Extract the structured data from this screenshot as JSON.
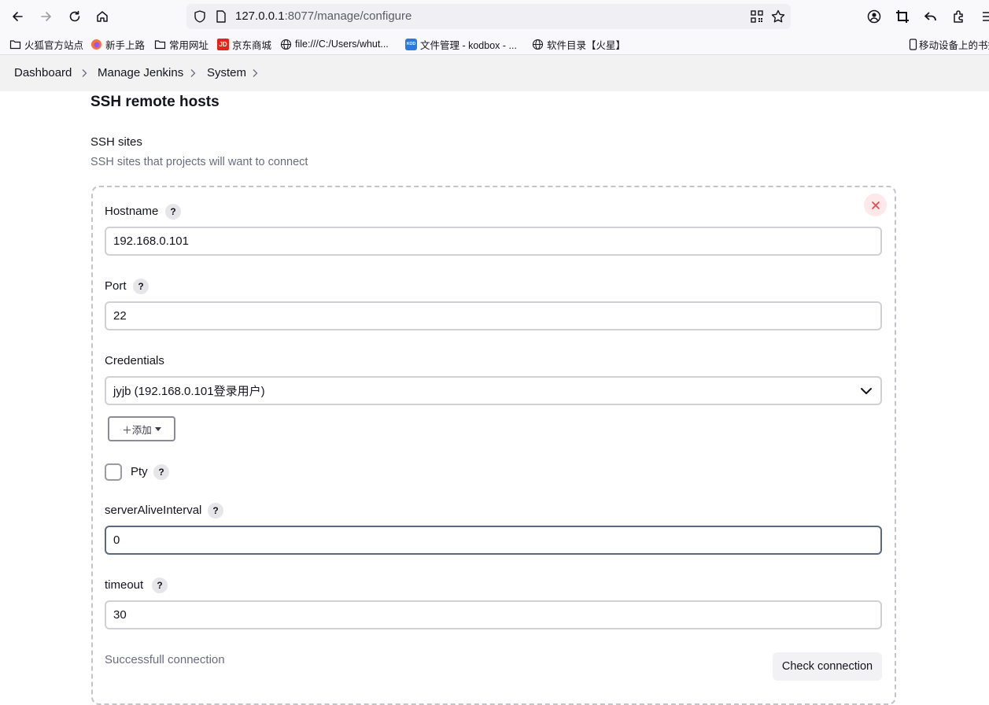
{
  "browser": {
    "url_host": "127.0.0.1",
    "url_rest": ":8077/manage/configure",
    "bookmarks": [
      {
        "label": "火狐官方站点",
        "icon": "folder-icon"
      },
      {
        "label": "新手上路",
        "icon": "firefox-icon"
      },
      {
        "label": "常用网址",
        "icon": "folder-icon"
      },
      {
        "label": "京东商城",
        "icon": "jd-icon"
      },
      {
        "label": "file:///C:/Users/whut...",
        "icon": "globe-icon"
      },
      {
        "label": "文件管理 - kodbox - ...",
        "icon": "kodbox-icon"
      },
      {
        "label": "软件目录【火星】",
        "icon": "globe-icon"
      },
      {
        "label": "移动设备上的书签",
        "icon": "mobile-icon"
      }
    ],
    "jd_label": "JD",
    "kod_label": "KOD"
  },
  "breadcrumb": {
    "items": [
      "Dashboard",
      "Manage Jenkins",
      "System"
    ]
  },
  "section": {
    "title": "SSH remote hosts",
    "sites_label": "SSH sites",
    "sites_description": "SSH sites that projects will want to connect"
  },
  "form": {
    "help_glyph": "?",
    "hostname_label": "Hostname",
    "hostname_value": "192.168.0.101",
    "port_label": "Port",
    "port_value": "22",
    "credentials_label": "Credentials",
    "credentials_value": "jyjb (192.168.0.101登录用户)",
    "add_label": "＋添加",
    "pty_label": "Pty",
    "pty_checked": false,
    "server_alive_label": "serverAliveInterval",
    "server_alive_value": "0",
    "timeout_label": "timeout",
    "timeout_value": "30",
    "status_text": "Successfull connection",
    "check_button": "Check connection"
  },
  "colors": {
    "delete_icon": "#e5484d",
    "delete_bg": "#fde8ea",
    "jd_red": "#e1251b",
    "kod_blue": "#2a7ae2"
  }
}
